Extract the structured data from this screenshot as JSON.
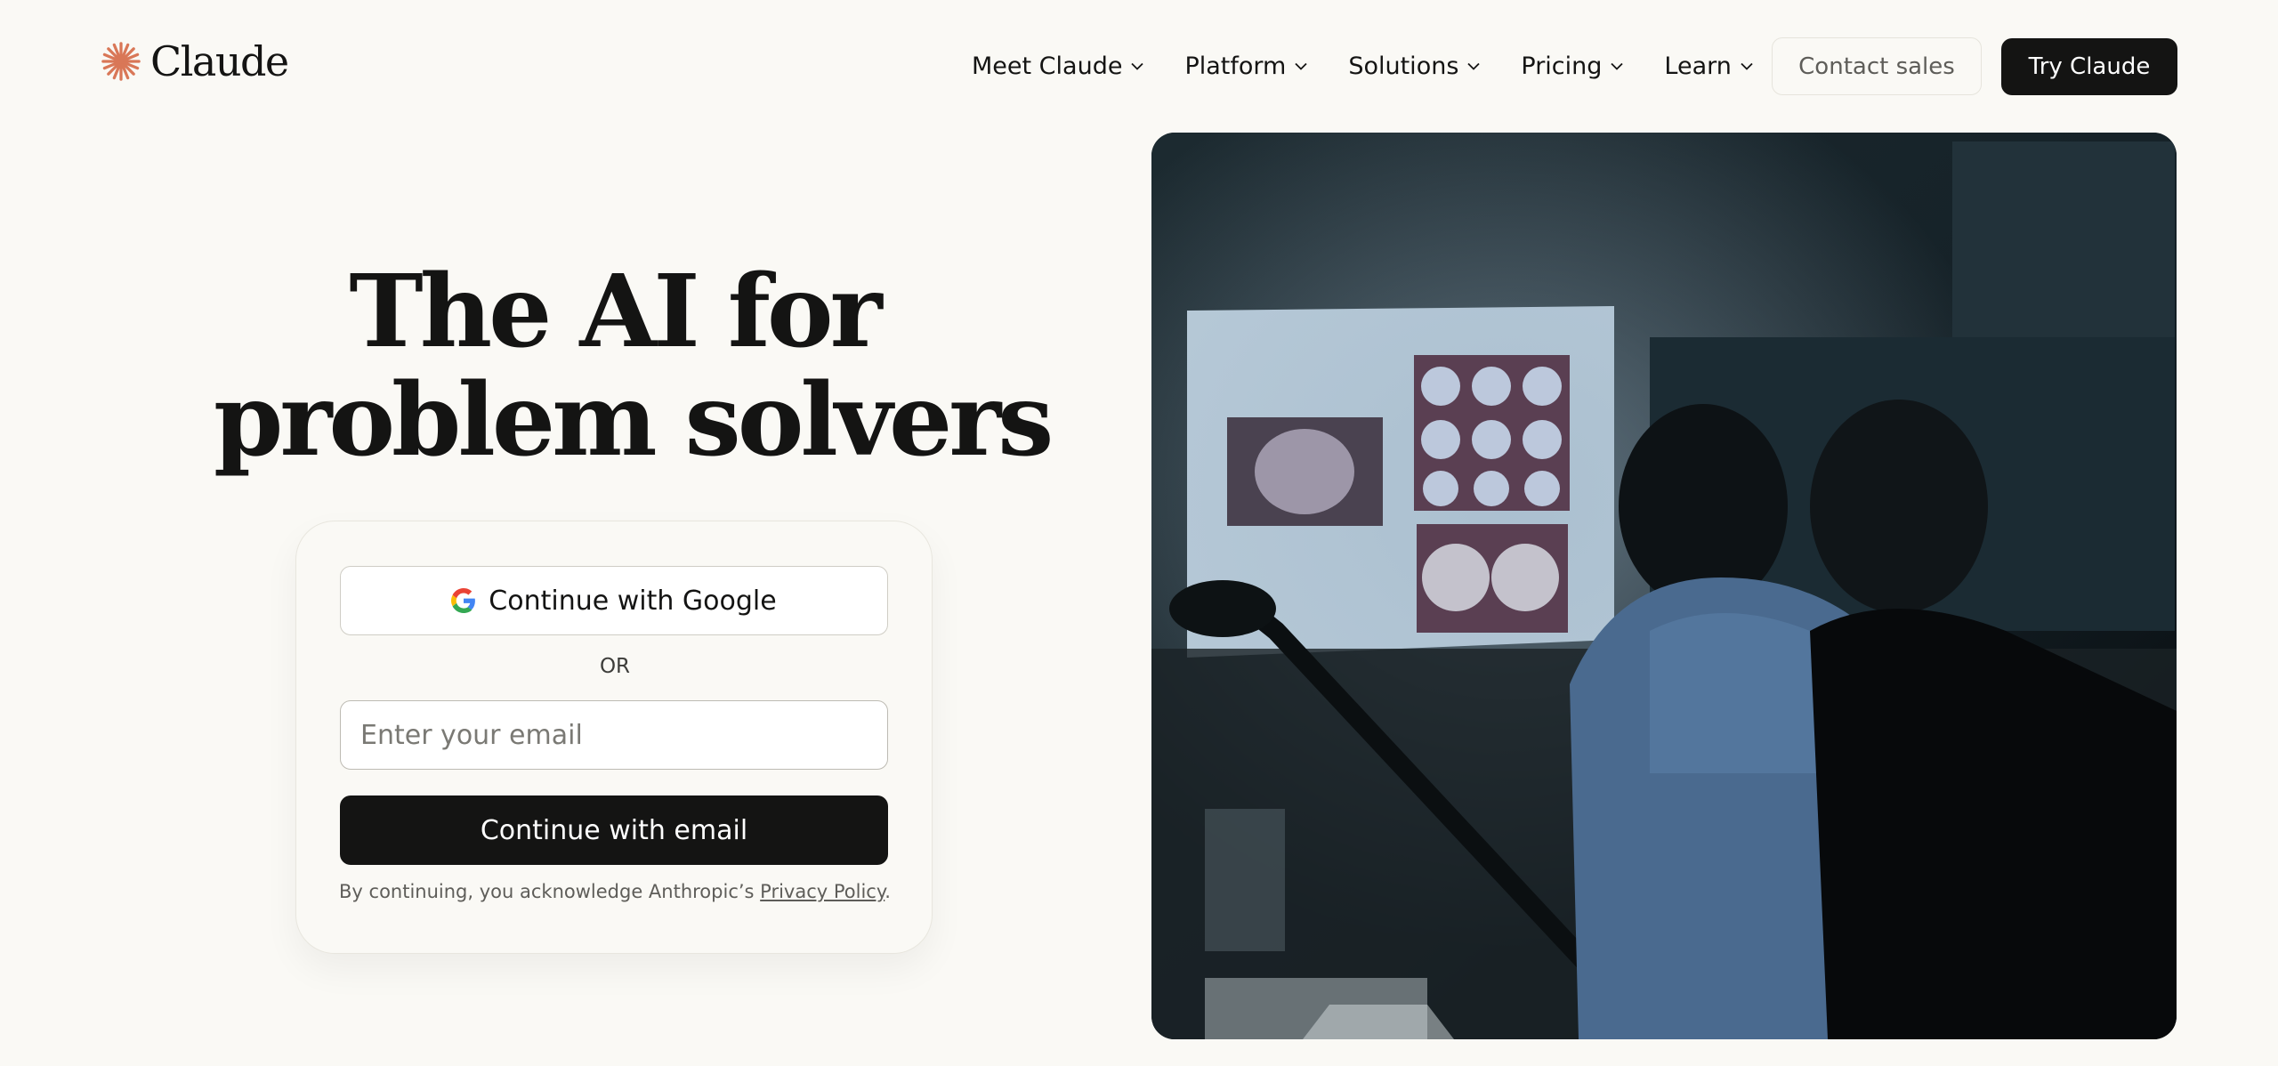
{
  "brand": {
    "name": "Claude",
    "logo_icon": "claude-starburst-icon",
    "accent_color": "#d97757"
  },
  "nav": {
    "items": [
      {
        "label": "Meet Claude",
        "icon": "chevron-down-icon"
      },
      {
        "label": "Platform",
        "icon": "chevron-down-icon"
      },
      {
        "label": "Solutions",
        "icon": "chevron-down-icon"
      },
      {
        "label": "Pricing",
        "icon": "chevron-down-icon"
      },
      {
        "label": "Learn",
        "icon": "chevron-down-icon"
      }
    ],
    "contact_label": "Contact sales",
    "try_label": "Try Claude"
  },
  "hero": {
    "title_line1": "The AI for",
    "title_line2": "problem solvers"
  },
  "signin": {
    "google_label": "Continue with Google",
    "google_icon": "google-g-icon",
    "or_label": "OR",
    "email_placeholder": "Enter your email",
    "email_value": "",
    "email_button_label": "Continue with email",
    "legal_prefix": "By continuing, you acknowledge Anthropic’s ",
    "legal_link": "Privacy Policy",
    "legal_suffix": "."
  },
  "hero_image": {
    "subject": "people-examining-brain-scans-photo"
  }
}
